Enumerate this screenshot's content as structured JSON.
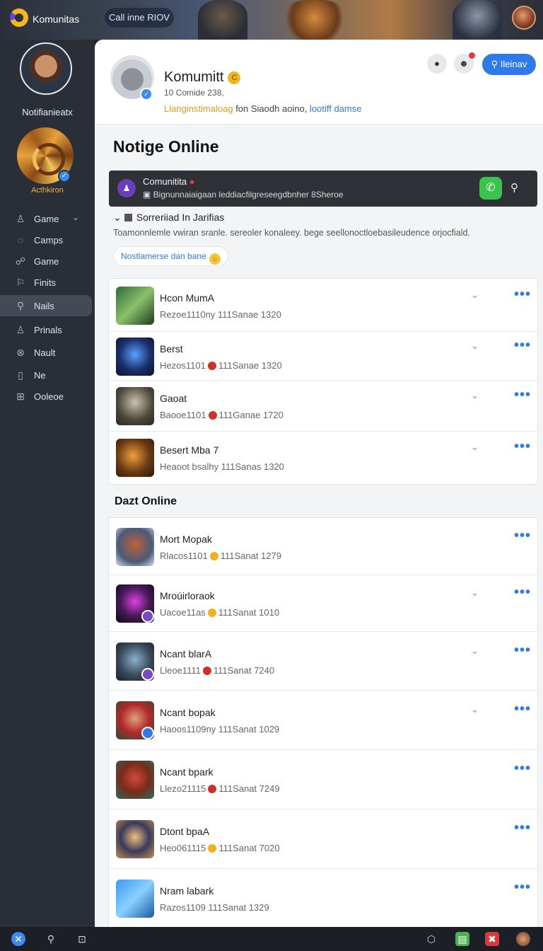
{
  "topbar": {
    "brand": "Komunitas",
    "pill": "Call inne RIOV"
  },
  "sidebar": {
    "name": "Notifianieatx",
    "sub": "Acthkiron",
    "items": [
      {
        "label": "Game",
        "icon": "user-icon",
        "chevron": "⌄"
      },
      {
        "label": "Camps",
        "icon": "chat-icon"
      },
      {
        "label": "Game",
        "icon": "gamepad-icon"
      },
      {
        "label": "Finits",
        "icon": "flag-icon"
      },
      {
        "label": "Nails",
        "icon": "search-icon"
      },
      {
        "label": "Prinals",
        "icon": "person-icon"
      },
      {
        "label": "Nault",
        "icon": "circle-x-icon"
      },
      {
        "label": "Ne",
        "icon": "phone-icon"
      },
      {
        "label": "Ooleoe",
        "icon": "grid-icon"
      }
    ]
  },
  "profile": {
    "title": "Komumitt",
    "coin": "C",
    "meta": "10 Comide 238,",
    "desc_orange": "Llanginstimaloag",
    "desc_mid": " fon Siaodh aoino, ",
    "desc_blue": "lootiff damse",
    "follow": "Ileinav"
  },
  "heading": "Notige Online",
  "banner": {
    "title": "Comunitita",
    "subtitle": "Bignunnaiaigaan leddiacfilgreseegdbnher 8Sheroe"
  },
  "section": {
    "title": "Sorreriiad In Jarifias",
    "info": "Toamonnlemle vwiran sranle. sereoler konaleey. bege seellonoctloebasileudence orjocfiald.",
    "chip": "Nostlamerse dan bane"
  },
  "list1": [
    {
      "name": "Hcon MumA",
      "sub_a": "Rezoe1110ny",
      "sub_b": "111Sanae 1320",
      "status": "",
      "chevron": true
    },
    {
      "name": "Berst",
      "sub_a": "Hezos1101",
      "sub_b": "111Sanae 1320",
      "status": "#d0302a",
      "chevron": true
    },
    {
      "name": "Gaoat",
      "sub_a": "Baooe1101",
      "sub_b": "111Ganae 1720",
      "status": "#d0302a",
      "chevron": true
    },
    {
      "name": "Besert Mba 7",
      "sub_a": "Heaoot bsalhy",
      "sub_b": "111Sanas 1320",
      "status": "",
      "chevron": true
    }
  ],
  "heading2": "Dazt Online",
  "list2": [
    {
      "name": "Mort Mopak",
      "sub_a": "Rlacos1101",
      "sub_b": "111Sanat 1279",
      "status": "#f0b020",
      "chevron": false
    },
    {
      "name": "Mroúirloraok",
      "sub_a": "Uacoe11as",
      "sub_b": "111Sanat 1010",
      "status": "#f0b020",
      "chevron": true
    },
    {
      "name": "Ncant blarA",
      "sub_a": "Lleoe1111",
      "sub_b": "111Sanat 7240",
      "status": "#d0302a",
      "chevron": true
    },
    {
      "name": "Ncant bopak",
      "sub_a": "Haoos1109ny",
      "sub_b": "111Sanat 1029",
      "status": "",
      "chevron": true
    },
    {
      "name": "Ncant bpark",
      "sub_a": "Llezo21115",
      "sub_b": "111Sanat 7249",
      "status": "#d0302a",
      "chevron": false
    },
    {
      "name": "Dtont bpaA",
      "sub_a": "Heo061115",
      "sub_b": "111Sanat 7020",
      "status": "#f0b020",
      "chevron": false
    },
    {
      "name": "Nram labark",
      "sub_a": "Razos1109",
      "sub_b": "111Sanat 1329",
      "status": "",
      "chevron": false
    }
  ],
  "icons": {
    "more": "•••",
    "chevron": "⌄"
  }
}
